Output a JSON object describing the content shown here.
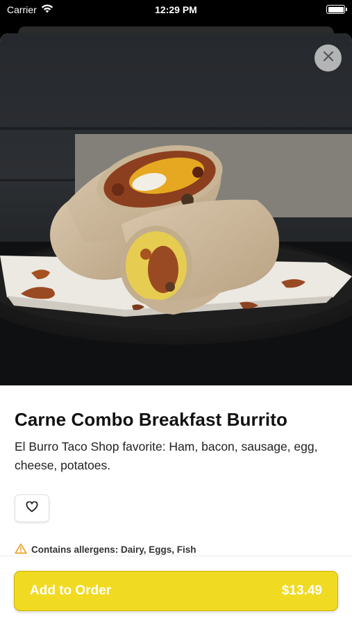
{
  "status_bar": {
    "carrier": "Carrier",
    "time": "12:29 PM"
  },
  "item": {
    "image_alt": "Carne Combo Breakfast Burrito photo",
    "title": "Carne Combo Breakfast Burrito",
    "description": "El Burro Taco Shop favorite: Ham, bacon, sausage, egg, cheese, potatoes.",
    "allergen_text": "Contains allergens: Dairy, Eggs, Fish"
  },
  "icons": {
    "close": "close-icon",
    "favorite": "heart-icon",
    "warning": "warning-icon",
    "wifi": "wifi-icon",
    "battery": "battery-icon"
  },
  "order_button": {
    "label": "Add to Order",
    "price": "$13.49"
  },
  "colors": {
    "accent": "#f1da22",
    "warning": "#e8a020"
  }
}
